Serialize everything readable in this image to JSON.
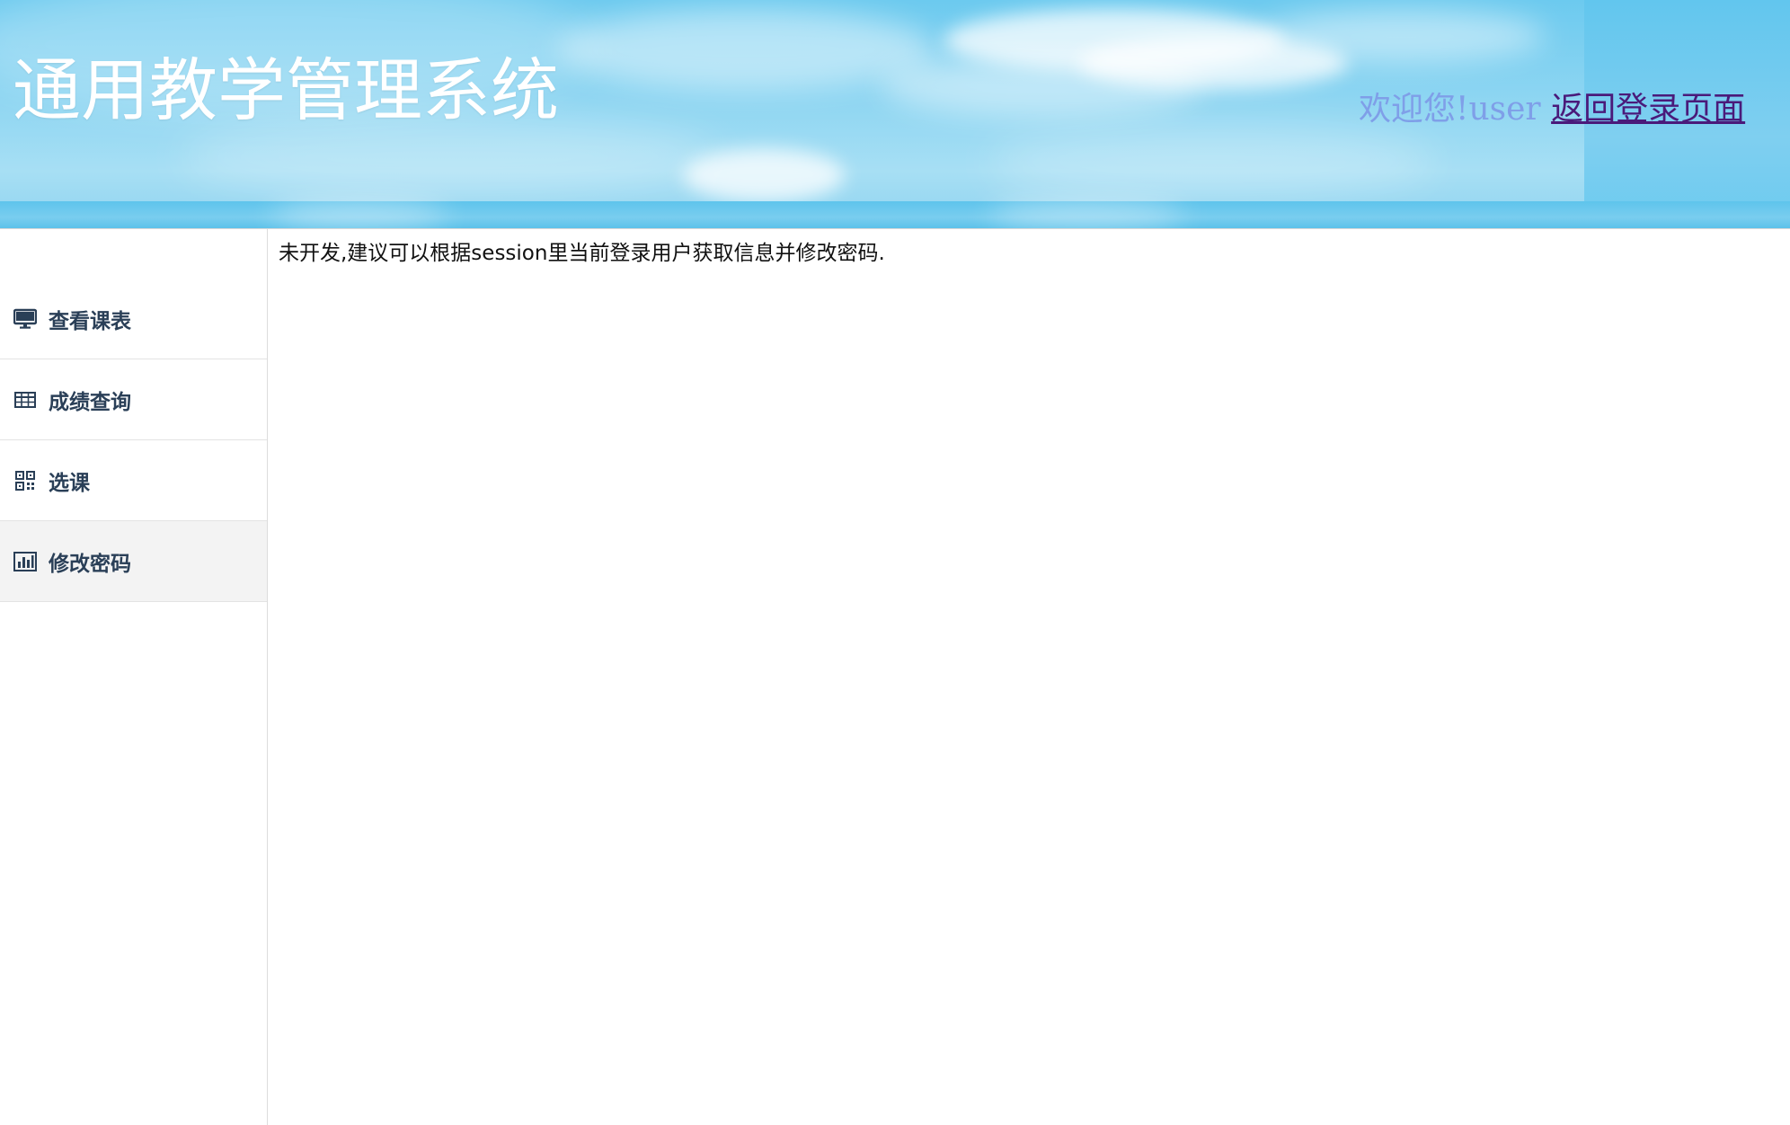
{
  "header": {
    "app_title": "通用教学管理系统",
    "welcome_text": "欢迎您!user",
    "back_link_label": "返回登录页面"
  },
  "sidebar": {
    "items": [
      {
        "label": "查看课表",
        "icon": "monitor-icon",
        "active": false
      },
      {
        "label": "成绩查询",
        "icon": "table-icon",
        "active": false
      },
      {
        "label": "选课",
        "icon": "qrcode-icon",
        "active": false
      },
      {
        "label": "修改密码",
        "icon": "bar-chart-icon",
        "active": true
      }
    ]
  },
  "main": {
    "message": "未开发,建议可以根据session里当前登录用户获取信息并修改密码."
  },
  "colors": {
    "sky": "#8fd6f2",
    "welcome": "#7f9fe8",
    "link": "#4a1a7a",
    "nav_text": "#2a3f57",
    "active_bg": "#f3f3f3"
  }
}
